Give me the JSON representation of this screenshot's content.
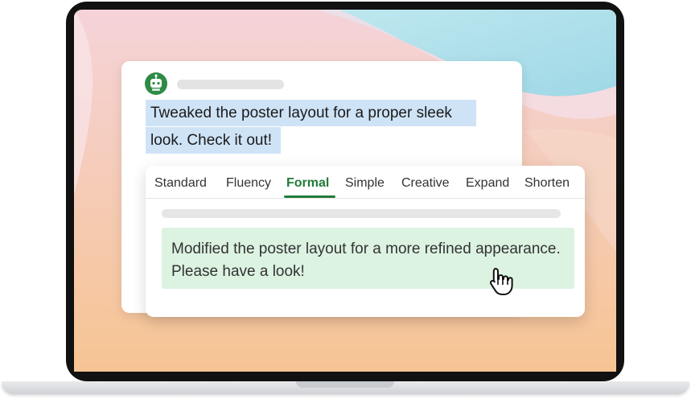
{
  "message": {
    "line_1": "Tweaked the poster layout for a proper sleek",
    "line_2": "look. Check it out!"
  },
  "rewrite": {
    "tabs": [
      {
        "label": "Standard"
      },
      {
        "label": "Fluency"
      },
      {
        "label": "Formal"
      },
      {
        "label": "Simple"
      },
      {
        "label": "Creative"
      },
      {
        "label": "Expand"
      },
      {
        "label": "Shorten"
      }
    ],
    "active_tab": "Formal",
    "suggestion": "Modified the poster layout for a more refined appearance. Please have a look!"
  },
  "icons": {
    "avatar": "robot-icon",
    "cursor": "hand-pointer-icon"
  },
  "colors": {
    "accent_green": "#237b3a",
    "avatar_green": "#2e8b45",
    "highlight_blue": "#cfe3f6",
    "suggestion_bg": "#dcf3e1"
  }
}
